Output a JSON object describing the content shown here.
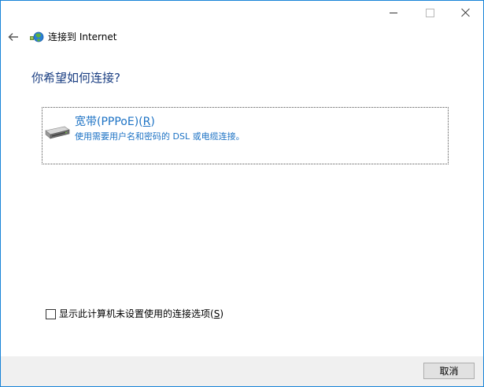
{
  "window": {
    "title": "连接到 Internet"
  },
  "heading": "你希望如何连接?",
  "option": {
    "title": "宽带(PPPoE)(",
    "title_mnemonic": "R",
    "title_end": ")",
    "description": "使用需要用户名和密码的 DSL 或电缆连接。"
  },
  "checkbox": {
    "label": "显示此计算机未设置使用的连接选项(",
    "label_mnemonic": "S",
    "label_end": ")",
    "checked": false
  },
  "footer": {
    "cancel_label": "取消"
  },
  "colors": {
    "accent": "#1c72c4",
    "heading": "#1a3e82",
    "border": "#1883d7",
    "footer_bg": "#f0f0f0"
  },
  "icons": {
    "back": "back-arrow-icon",
    "app": "network-globe-icon",
    "option": "broadband-drive-icon"
  }
}
